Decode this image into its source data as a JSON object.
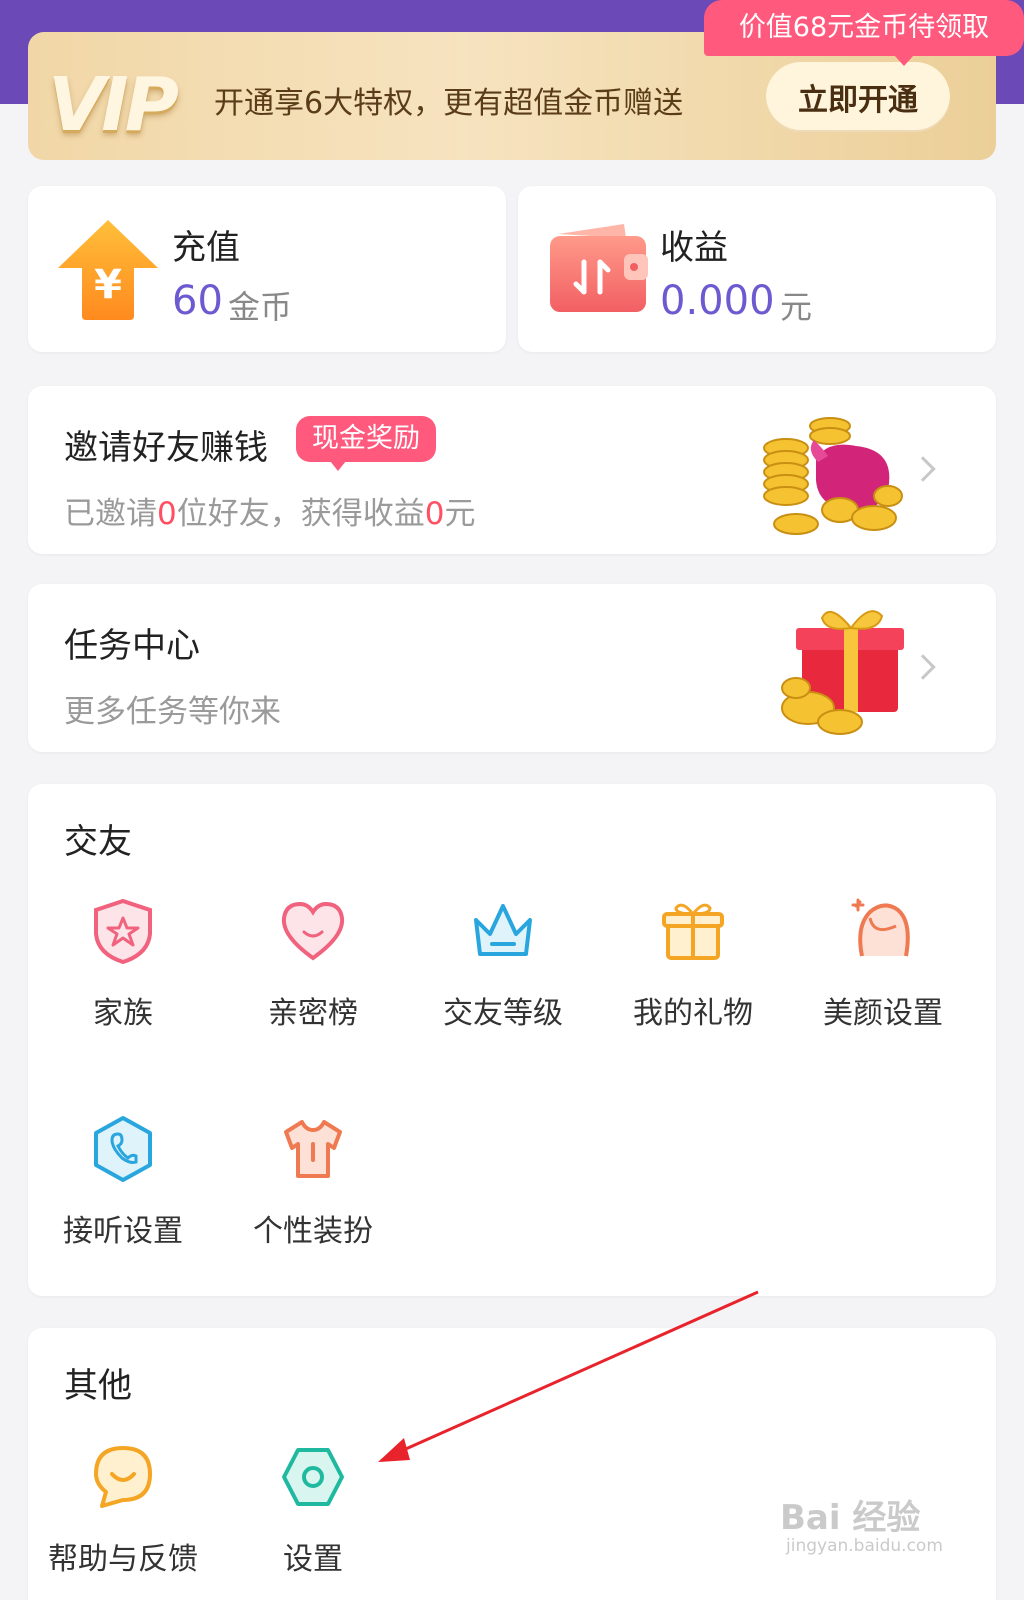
{
  "vip": {
    "logo": "VIP",
    "text": "开通享6大特权，更有超值金币赠送",
    "button": "立即开通",
    "tag": "价值68元金币待领取"
  },
  "recharge": {
    "title": "充值",
    "value": "60",
    "unit": "金币",
    "icon": "coin-upload-icon"
  },
  "earnings": {
    "title": "收益",
    "value": "0.000",
    "unit": "元",
    "icon": "wallet-icon"
  },
  "invite": {
    "title": "邀请好友赚钱",
    "badge": "现金奖励",
    "sub_prefix": "已邀请",
    "friends": "0",
    "sub_middle": "位好友，获得收益",
    "income": "0",
    "sub_suffix": "元"
  },
  "tasks": {
    "title": "任务中心",
    "sub": "更多任务等你来"
  },
  "social": {
    "title": "交友",
    "items": [
      {
        "label": "家族",
        "icon": "family-shield-icon"
      },
      {
        "label": "亲密榜",
        "icon": "heart-icon"
      },
      {
        "label": "交友等级",
        "icon": "crown-icon"
      },
      {
        "label": "我的礼物",
        "icon": "gift-icon"
      },
      {
        "label": "美颜设置",
        "icon": "beauty-face-icon"
      },
      {
        "label": "接听设置",
        "icon": "phone-hexagon-icon"
      },
      {
        "label": "个性装扮",
        "icon": "shirt-icon"
      }
    ]
  },
  "other": {
    "title": "其他",
    "items": [
      {
        "label": "帮助与反馈",
        "icon": "chat-smile-icon"
      },
      {
        "label": "设置",
        "icon": "settings-hexagon-icon"
      }
    ]
  },
  "watermark": {
    "brand": "Bai 经验",
    "url": "jingyan.baidu.com"
  },
  "colors": {
    "accent": "#6c5ad1",
    "pink": "#ff5a7e",
    "red": "#ff4f63"
  }
}
